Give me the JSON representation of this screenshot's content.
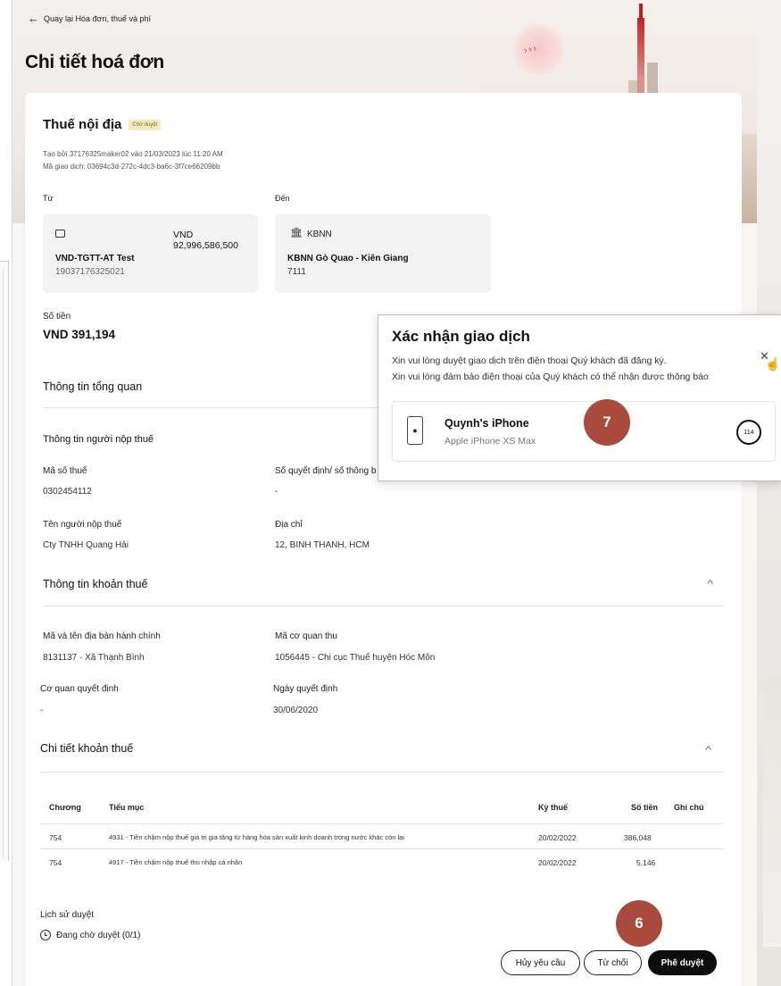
{
  "nav": {
    "back_label": "Quay lại Hóa đơn, thuế và phí"
  },
  "page": {
    "title": "Chi tiết hoá đơn"
  },
  "tax": {
    "title": "Thuế nội địa",
    "status_badge": "Chờ duyệt",
    "created_line": "Tạo bởi 37176325maker02 vào 21/03/2023 lúc 11:20 AM",
    "txn_line": "Mã giao dịch: 03694c3d-272c-4dc3-ba6c-3f7ce66209bb"
  },
  "from": {
    "label": "Từ",
    "balance": "VND  92,996,586,500",
    "name": "VND-TGTT-AT Test",
    "number": "19037176325021",
    "icon": "wallet-icon"
  },
  "to": {
    "label": "Đến",
    "bank": "KBNN",
    "name": "KBNN Gò Quao - Kiên Giang",
    "code": "7111",
    "icon": "bank-icon"
  },
  "amount": {
    "label": "Số tiền",
    "value": "VND 391,194"
  },
  "overview": {
    "title": "Thông tin tổng quan"
  },
  "payer": {
    "title": "Thông tin người nộp thuế",
    "tax_code_label": "Mã số thuế",
    "tax_code": "0302454112",
    "decision_label": "Số quyết định/ số thông b",
    "decision_value": "-",
    "name_label": "Tên người nộp thuế",
    "name": "Cty TNHH Quang Hải",
    "address_label": "Địa chỉ",
    "address": "12, BINH THANH, HCM"
  },
  "tax_info": {
    "title": "Thông tin khoản thuế",
    "area_label": "Mã và tên địa bàn hành chính",
    "area": "8131137 - Xã Thạnh Bình",
    "agency_label": "Mã cơ quan thu",
    "agency": "1056445 - Chi cục Thuế huyện Hóc Môn",
    "decider_label": "Cơ quan quyết định",
    "decider": "-",
    "date_label": "Ngày quyết định",
    "date": "30/06/2020"
  },
  "detail": {
    "title": "Chi tiết khoản thuế",
    "headers": [
      "Chương",
      "Tiểu mục",
      "Kỳ thuế",
      "Số tiền",
      "Ghi chú"
    ],
    "rows": [
      {
        "chapter": "754",
        "item": "4931 - Tiền chậm nộp thuế giá trị gia tăng từ hàng hóa sản xuất kinh doanh trong nước khác còn lại",
        "period": "20/02/2022",
        "amount": "386,048",
        "note": ""
      },
      {
        "chapter": "754",
        "item": "4917 - Tiền chậm nộp thuế thu nhập cá nhân",
        "period": "20/02/2022",
        "amount": "5,146",
        "note": ""
      }
    ]
  },
  "history": {
    "title": "Lịch sử duyệt",
    "status": "Đang chờ duyệt (0/1)"
  },
  "actions": {
    "cancel": "Hủy yêu cầu",
    "reject": "Từ chối",
    "approve": "Phê duyệt"
  },
  "markers": {
    "approve_step": "6",
    "confirm_step": "7"
  },
  "modal": {
    "title": "Xác nhận giao dịch",
    "line1": "Xin vui lòng duyệt giao dịch trên điện thoại Quý khách đã đăng ký.",
    "line2": "Xin vui lòng đảm bảo điện thoại của Quý khách có thể nhận được thông báo",
    "device_name": "Quynh's iPhone",
    "device_model": "Apple iPhone XS Max",
    "countdown": "114"
  },
  "colors": {
    "marker": "#a84a3d",
    "badge_bg": "#f3e9c2",
    "primary_button": "#0d0d0d"
  }
}
